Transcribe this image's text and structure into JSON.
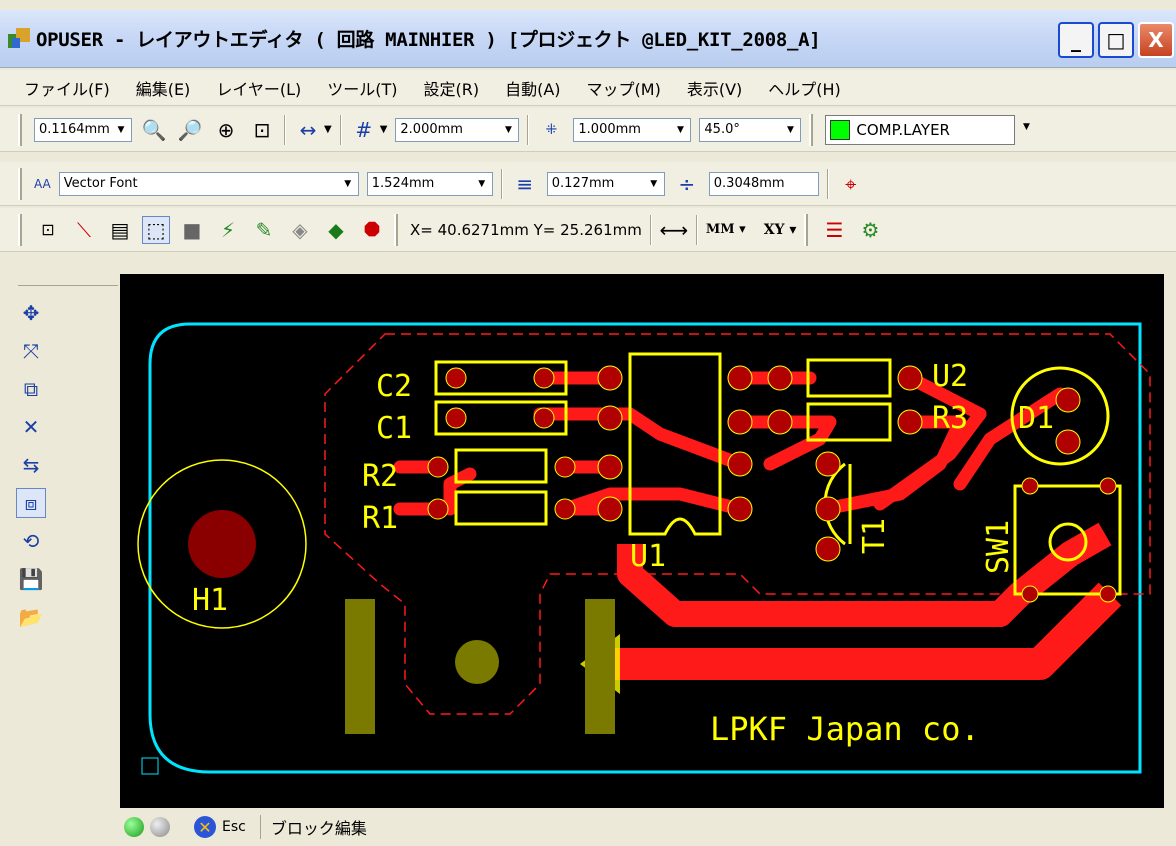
{
  "window": {
    "title": "OPUSER - レイアウトエディタ ( 回路 MAINHIER ) [プロジェクト @LED_KIT_2008_A]",
    "buttons": {
      "minimize": "_",
      "maximize": "□",
      "close": "X"
    }
  },
  "menu": [
    "ファイル(F)",
    "編集(E)",
    "レイヤー(L)",
    "ツール(T)",
    "設定(R)",
    "自動(A)",
    "マップ(M)",
    "表示(V)",
    "ヘルプ(H)"
  ],
  "toolbar1": {
    "zoom_value": "0.1164mm",
    "grid_value": "2.000mm",
    "snap_value": "1.000mm",
    "angle_value": "45.0°",
    "layer_name": "COMP.LAYER",
    "layer_color": "#00ff00"
  },
  "toolbar2": {
    "font_name": "Vector Font",
    "text_height": "1.524mm",
    "line_width": "0.127mm",
    "clearance": "0.3048mm",
    "font_label": "AA"
  },
  "toolbar3": {
    "coords": "X= 40.6271mm  Y= 25.261mm",
    "units": "MM",
    "mode": "XY"
  },
  "pcb": {
    "labels": [
      "C2",
      "C1",
      "R2",
      "R1",
      "U1",
      "U2",
      "R3",
      "D1",
      "T1",
      "SW1",
      "H1"
    ],
    "company": "LPKF Japan co.",
    "colors": {
      "outline": "#00e5ff",
      "silk": "#ffff00",
      "copper": "#ff1a1a",
      "pad": "#b00000",
      "keepout": "#ffff00"
    }
  },
  "status": {
    "esc_label": "Esc",
    "mode_text": "ブロック編集"
  }
}
